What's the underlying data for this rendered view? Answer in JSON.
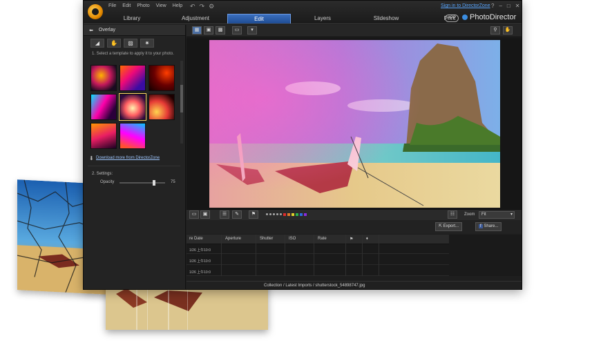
{
  "window": {
    "menu": [
      "File",
      "Edit",
      "Photo",
      "View",
      "Help"
    ],
    "signin_link": "Sign in to DirectorZone",
    "help_mark": "?",
    "app_badge": "APP",
    "brand": "PhotoDirector",
    "tabs": [
      {
        "label": "Library",
        "active": false
      },
      {
        "label": "Adjustment",
        "active": false
      },
      {
        "label": "Edit",
        "active": true
      },
      {
        "label": "Layers",
        "active": false
      },
      {
        "label": "Slideshow",
        "active": false
      },
      {
        "label": "Print",
        "active": false
      }
    ]
  },
  "panel": {
    "title": "Overlay",
    "instruction": "1. Select a template to apply it to your photo.",
    "download_link": "Download more from DirectorZone",
    "settings_heading": "2. Settings:",
    "opacity_label": "Opacity",
    "opacity_value": "75",
    "opacity_fraction": 0.75
  },
  "viewer": {
    "zoom_label": "Zoom",
    "zoom_value": "Fit",
    "export_label": "Export...",
    "share_label": "Share...",
    "color_labels": [
      "#e02b2b",
      "#e07a2b",
      "#e0d12b",
      "#2bb24c",
      "#2b6be0",
      "#8a2be0"
    ]
  },
  "table": {
    "columns": [
      "re Date",
      "Aperture",
      "Shutter",
      "ISO",
      "Rate"
    ],
    "rows": [
      "1/26 上午10:0",
      "1/26 上午10:0",
      "1/26 上午10:0"
    ]
  },
  "path": "Collection / Latest Imports / shutterstock_54898747.jpg",
  "colors": {
    "accent": "#2f67c2",
    "link": "#5aa7ff"
  }
}
